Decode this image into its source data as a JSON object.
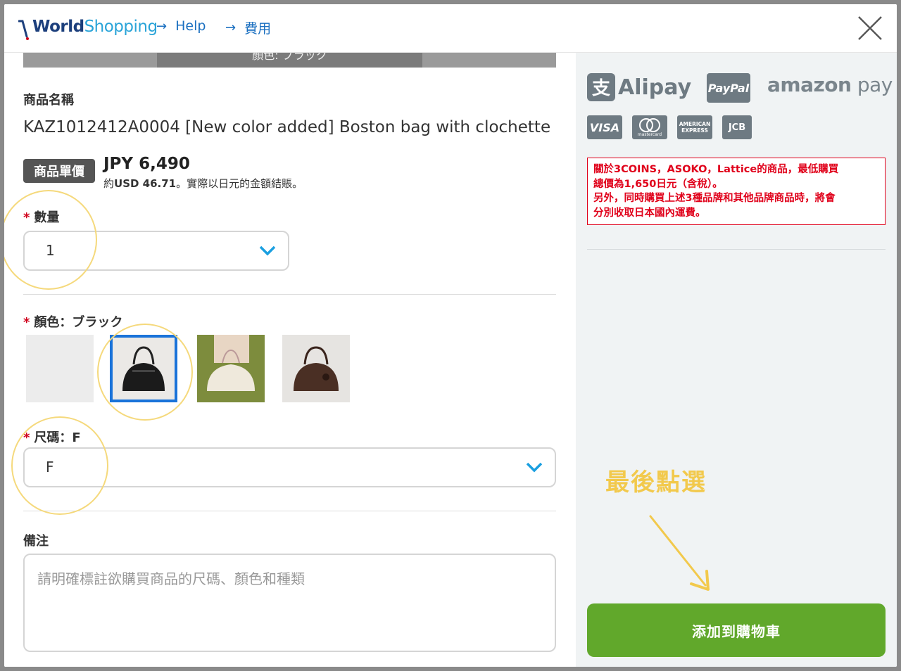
{
  "header": {
    "logo_w": "W",
    "logo_rest_1": "orld",
    "logo_rest_2": "Shopping",
    "breadcrumbs": [
      {
        "label": "Help"
      },
      {
        "label": "費用"
      }
    ]
  },
  "product": {
    "top_strip_caption": "顏色: ブラック",
    "name_label": "商品名稱",
    "name": "KAZ1012412A0004 [New color added] Boston bag with clochette",
    "price_badge": "商品單價",
    "price_main": "JPY 6,490",
    "price_sub_prefix": "約",
    "price_sub_usd": "USD 46.71",
    "price_sub_suffix": "。實際以日元的金額結賬。"
  },
  "quantity": {
    "required_mark": "*",
    "label": "數量",
    "value": "1"
  },
  "color": {
    "required_mark": "*",
    "label": "顏色：ブラック",
    "swatches": [
      {
        "name": "blank",
        "selected": false
      },
      {
        "name": "black",
        "selected": true
      },
      {
        "name": "ivory",
        "selected": false
      },
      {
        "name": "brown",
        "selected": false
      }
    ]
  },
  "size": {
    "required_mark": "*",
    "label": "尺碼：F",
    "value": "F"
  },
  "notes": {
    "label": "備注",
    "placeholder": "請明確標註欲購買商品的尺碼、顏色和種類"
  },
  "payment": {
    "alipay": "Alipay",
    "paypal": "PayPal",
    "amazon_1": "amazon",
    "amazon_2": " pay",
    "visa": "VISA",
    "mastercard": "mastercard",
    "amex_1": "AMERICAN",
    "amex_2": "EXPRESS",
    "jcb": "JCB"
  },
  "notice": {
    "lines": [
      "關於3COINS，ASOKO，Lattice的商品，最低購買",
      "總價為1,650日元（含稅）。",
      "另外，同時購買上述3種品牌和其他品牌商品時，將會",
      "分別收取日本國內運費。"
    ]
  },
  "annotation": {
    "hand_note": "最後點選"
  },
  "cart": {
    "button_label": "添加到購物車"
  },
  "colors": {
    "accent_blue": "#1a73d9",
    "cart_green": "#61a82b",
    "notice_red": "#e0001a",
    "highlight_yellow": "#f5d97c"
  }
}
